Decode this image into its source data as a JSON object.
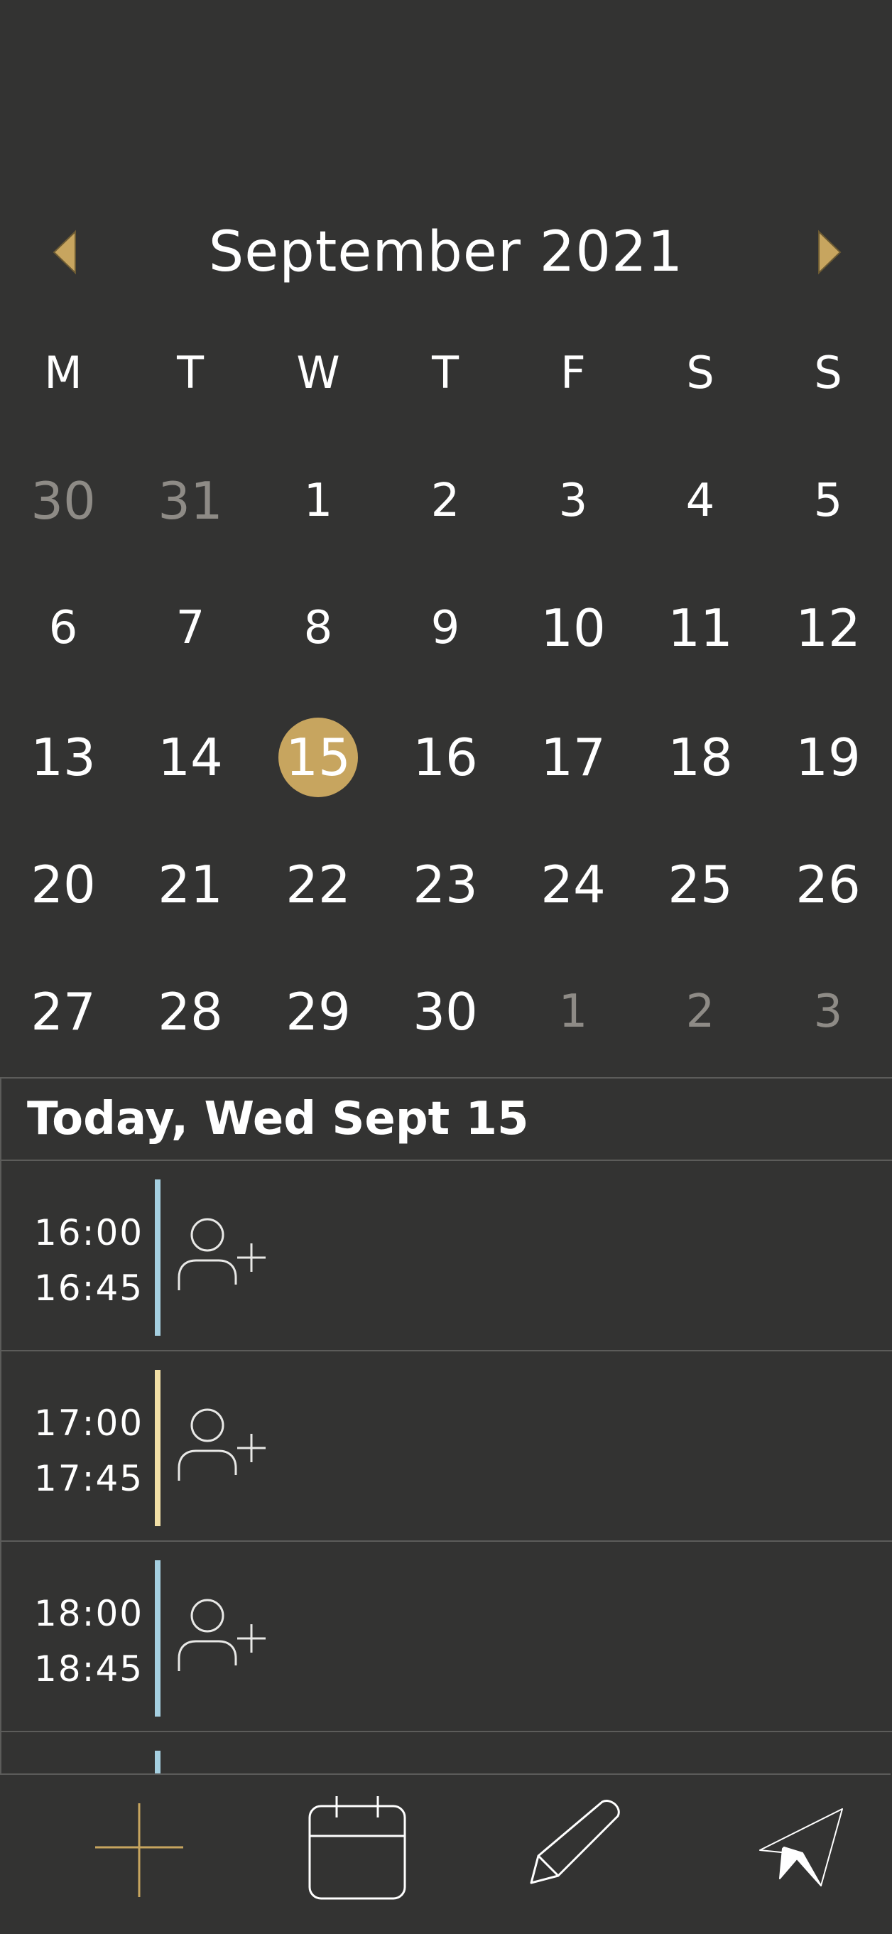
{
  "calendar": {
    "month_title": "September 2021",
    "prev_month_label": "previous month",
    "next_month_label": "next month",
    "weekdays": [
      "M",
      "T",
      "W",
      "T",
      "F",
      "S",
      "S"
    ],
    "weeks": [
      [
        {
          "d": "30",
          "m": true
        },
        {
          "d": "31",
          "m": true
        },
        {
          "d": "1"
        },
        {
          "d": "2"
        },
        {
          "d": "3"
        },
        {
          "d": "4"
        },
        {
          "d": "5"
        }
      ],
      [
        {
          "d": "6"
        },
        {
          "d": "7"
        },
        {
          "d": "8"
        },
        {
          "d": "9"
        },
        {
          "d": "10"
        },
        {
          "d": "11"
        },
        {
          "d": "12"
        }
      ],
      [
        {
          "d": "13"
        },
        {
          "d": "14"
        },
        {
          "d": "15",
          "today": true
        },
        {
          "d": "16"
        },
        {
          "d": "17"
        },
        {
          "d": "18"
        },
        {
          "d": "19"
        }
      ],
      [
        {
          "d": "20"
        },
        {
          "d": "21"
        },
        {
          "d": "22"
        },
        {
          "d": "23"
        },
        {
          "d": "24"
        },
        {
          "d": "25"
        },
        {
          "d": "26"
        }
      ],
      [
        {
          "d": "27"
        },
        {
          "d": "28"
        },
        {
          "d": "29"
        },
        {
          "d": "30"
        },
        {
          "d": "1",
          "m": true
        },
        {
          "d": "2",
          "m": true
        },
        {
          "d": "3",
          "m": true
        }
      ]
    ],
    "accent_color": "#c7a55f"
  },
  "today": {
    "title": "Today, Wed Sept 15"
  },
  "events": [
    {
      "start": "16:00",
      "end": "16:45",
      "color": "#a5cfe0",
      "icon": "add-person-icon"
    },
    {
      "start": "17:00",
      "end": "17:45",
      "color": "#f1dfa6",
      "icon": "add-person-icon"
    },
    {
      "start": "18:00",
      "end": "18:45",
      "color": "#a5cfe0",
      "icon": "add-person-icon"
    },
    {
      "start": "",
      "end": "",
      "color": "#a5cfe0",
      "icon": "add-person-icon"
    }
  ],
  "bottom_nav": [
    {
      "icon": "plus-icon",
      "color": "#c7a55f"
    },
    {
      "icon": "calendar-icon",
      "color": "#ffffff"
    },
    {
      "icon": "pencil-icon",
      "color": "#ffffff"
    },
    {
      "icon": "send-icon",
      "color": "#ffffff"
    }
  ]
}
